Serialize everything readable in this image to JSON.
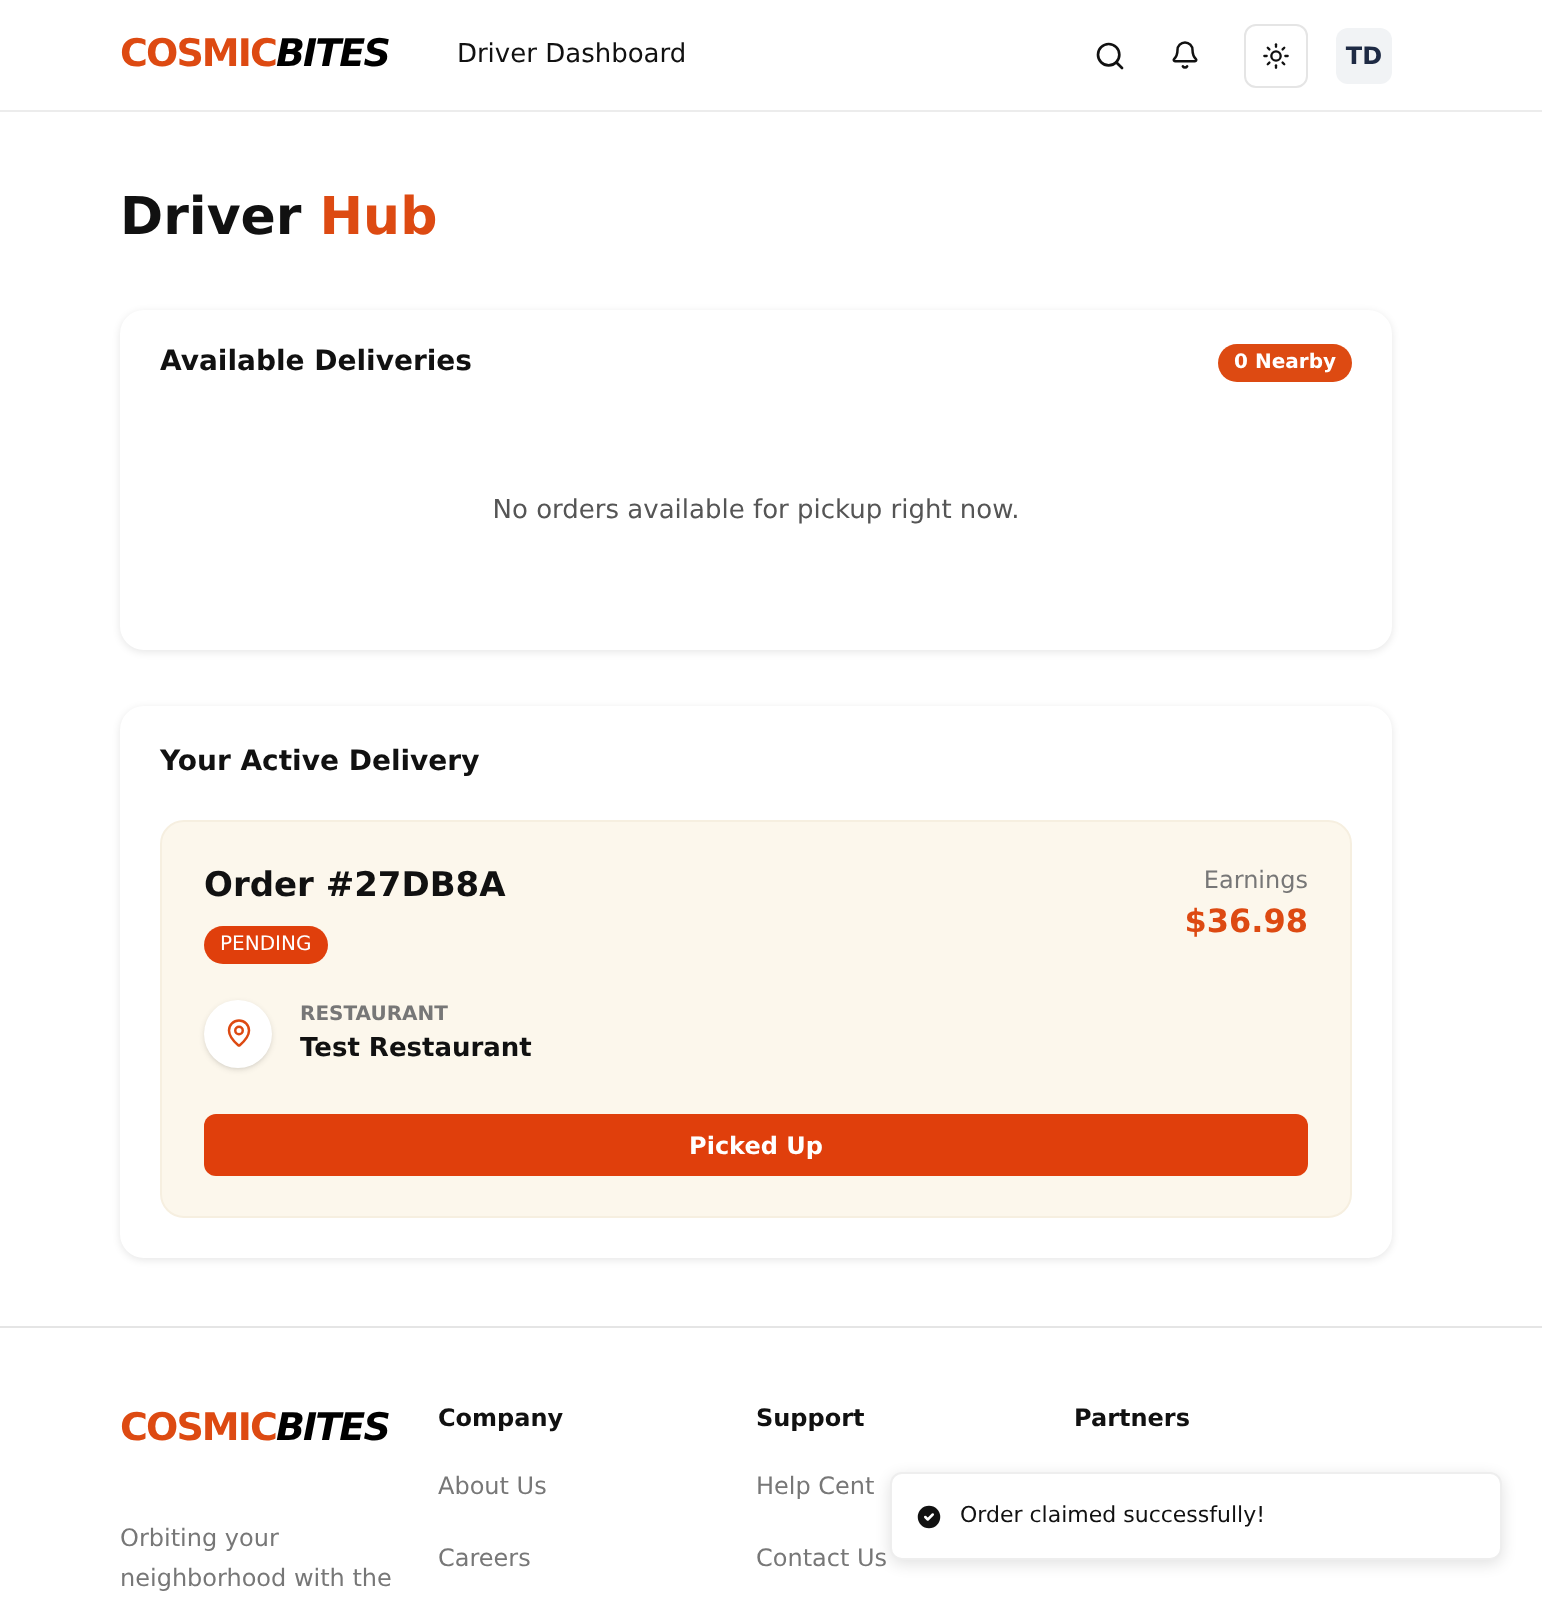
{
  "header": {
    "logo": {
      "part1": "COSMIC",
      "part2": "BITES"
    },
    "nav_title": "Driver Dashboard",
    "avatar": "TD"
  },
  "page_title": {
    "part1": "Driver",
    "part2": "Hub"
  },
  "available": {
    "title": "Available Deliveries",
    "badge": "0 Nearby",
    "empty_text": "No orders available for pickup right now."
  },
  "active": {
    "title": "Your Active Delivery",
    "order": "Order #27DB8A",
    "status": "PENDING",
    "earnings_label": "Earnings",
    "earnings": "$36.98",
    "restaurant_label": "RESTAURANT",
    "restaurant": "Test Restaurant",
    "action": "Picked Up"
  },
  "footer": {
    "logo": {
      "part1": "COSMIC",
      "part2": "BITES"
    },
    "tagline": "Orbiting your neighborhood with the",
    "columns": [
      {
        "title": "Company",
        "links": [
          "About Us",
          "Careers"
        ]
      },
      {
        "title": "Support",
        "links": [
          "Help Cent",
          "Contact Us"
        ]
      },
      {
        "title": "Partners"
      }
    ]
  },
  "toast": {
    "text": "Order claimed successfully!"
  }
}
